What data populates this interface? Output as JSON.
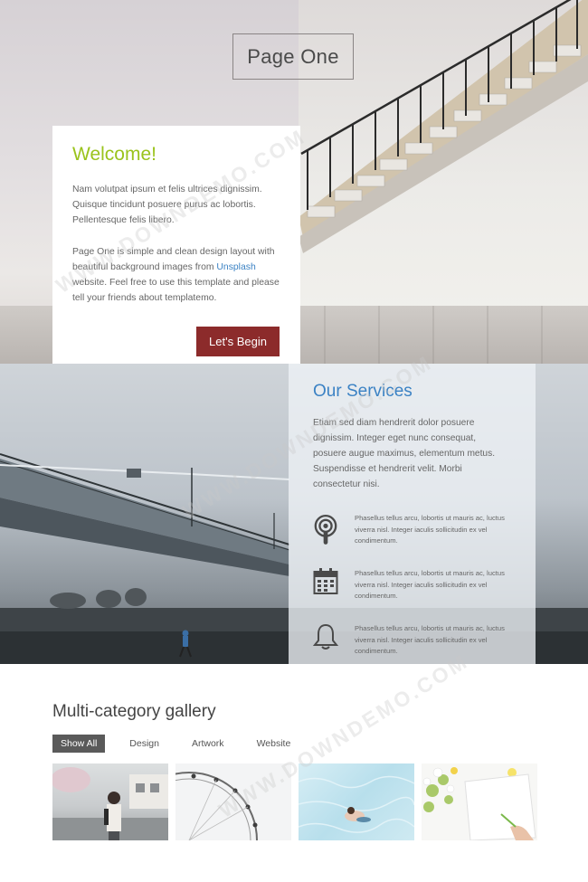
{
  "hero": {
    "title": "Page One"
  },
  "welcome": {
    "heading": "Welcome!",
    "para1": "Nam volutpat ipsum et felis ultrices dignissim. Quisque tincidunt posuere purus ac lobortis. Pellentesque felis libero.",
    "para2_before_link": "Page One is simple and clean design layout with beautiful background images from ",
    "link_text": "Unsplash",
    "para2_after_link": " website. Feel free to use this template and please tell your friends about templatemo.",
    "button_label": "Let's Begin",
    "colors": {
      "heading": "#9ac31c",
      "button": "#8c2b2b",
      "link": "#3b82c4"
    }
  },
  "services": {
    "heading": "Our Services",
    "intro": "Etiam sed diam hendrerit dolor posuere dignissim. Integer eget nunc consequat, posuere augue maximus, elementum metus. Suspendisse et hendrerit velit. Morbi consectetur nisi.",
    "items": [
      {
        "icon": "podcast-icon",
        "text": "Phasellus tellus arcu, lobortis ut mauris ac, luctus viverra nisl. Integer iaculis sollicitudin ex vel condimentum."
      },
      {
        "icon": "calendar-icon",
        "text": "Phasellus tellus arcu, lobortis ut mauris ac, luctus viverra nisl. Integer iaculis sollicitudin ex vel condimentum."
      },
      {
        "icon": "bell-icon",
        "text": "Phasellus tellus arcu, lobortis ut mauris ac, luctus viverra nisl. Integer iaculis sollicitudin ex vel condimentum."
      }
    ]
  },
  "gallery": {
    "title": "Multi-category gallery",
    "filters": [
      "Show All",
      "Design",
      "Artwork",
      "Website"
    ],
    "active_filter": "Show All"
  },
  "watermark": "WWW.DOWNDEMO.COM"
}
